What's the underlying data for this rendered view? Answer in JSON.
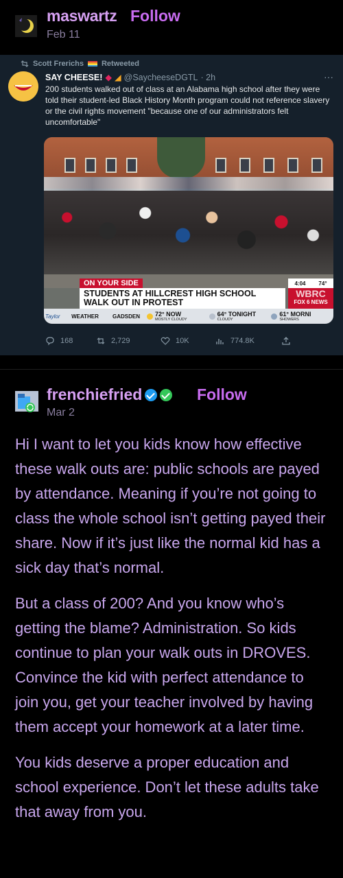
{
  "post1": {
    "username": "maswartz",
    "follow_label": "Follow",
    "date": "Feb 11",
    "avatar_icon": "moon-avatar-icon"
  },
  "tweet": {
    "retweeted_by": "Scott Frerichs",
    "retweeted_label": "Retweeted",
    "display_name": "SAY CHEESE!",
    "handle": "@SaycheeseDGTL",
    "time": "· 2h",
    "text": "200 students walked out of class at an Alabama high school after they were told their student-led Black History Month program could not reference slavery or the civil rights movement \"because one of our administrators felt uncomfortable\"",
    "media": {
      "banner_label": "ON YOUR SIDE",
      "headline_line1": "STUDENTS AT HILLCREST HIGH SCHOOL",
      "headline_line2": "WALK OUT IN PROTEST",
      "time": "4:04",
      "temp": "74°",
      "station_call": "WBRC",
      "station_network": "FOX 6 NEWS",
      "weather_brand": "Taylor",
      "weather_label": "WEATHER",
      "city": "GADSDEN",
      "forecast": [
        {
          "big": "72° NOW",
          "small": "MOSTLY CLOUDY"
        },
        {
          "big": "64° TONIGHT",
          "small": "CLOUDY"
        },
        {
          "big": "61° MORNI",
          "small": "SHOWERS"
        }
      ]
    },
    "metrics": {
      "replies": "168",
      "retweets": "2,729",
      "likes": "10K",
      "views": "774.8K"
    }
  },
  "post2": {
    "username": "frenchiefried",
    "follow_label": "Follow",
    "date": "Mar 2",
    "paragraphs": [
      "Hi I want to let you kids know how effective these walk outs are: public schools are payed by attendance. Meaning if you’re not going to class the whole school isn’t getting payed their share. Now if it’s just like the normal kid has a sick day that’s normal.",
      "But a class of 200? And you know who’s getting the blame? Administration. So kids continue to plan your walk outs in DROVES. Convince the kid with perfect attendance to join you, get your teacher involved by having them accept your homework at a later time.",
      "You kids deserve a proper education and school experience. Don’t let these adults take that away from you."
    ]
  },
  "colors": {
    "username": "#d6a0f2",
    "follow": "#c86cf0",
    "body_text": "#c9a7ee",
    "tweet_bg": "#15202b"
  }
}
